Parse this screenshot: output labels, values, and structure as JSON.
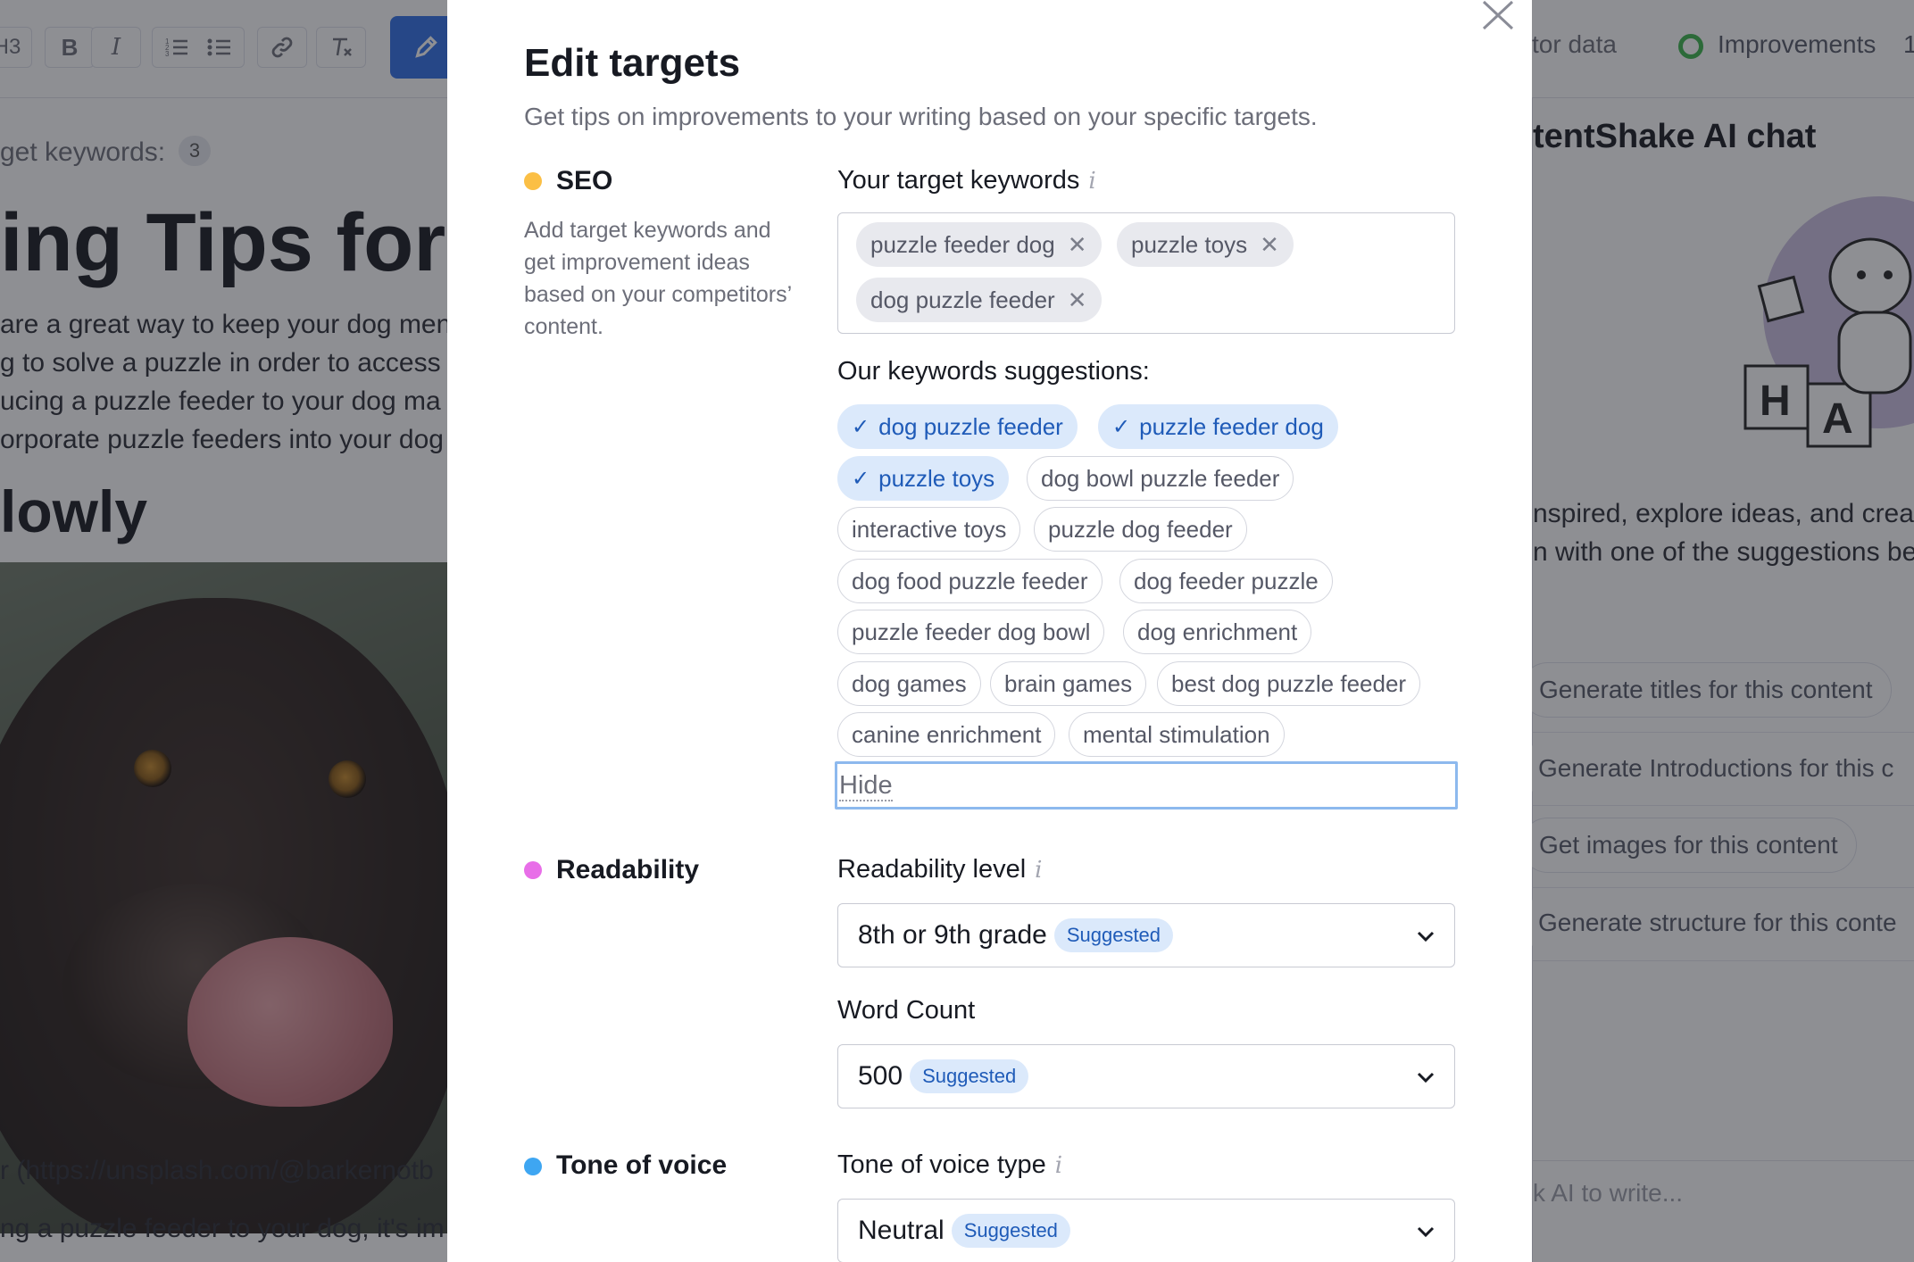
{
  "background": {
    "toolbar": {
      "heading_button": "H3",
      "bold_button": "B",
      "italic_button": "I",
      "competitor_data_label": "tor data",
      "improvements_label": "Improvements",
      "improvements_count": "1"
    },
    "editor": {
      "keywords_label": "get keywords:",
      "keywords_count": "3",
      "title": "ing Tips for U",
      "paragraph": "are a great way to keep your dog men\ng to solve a puzzle in order to access\nucing a puzzle feeder to your dog ma\norporate puzzle feeders into your dog",
      "heading2": "lowly",
      "caption": "r (https://unsplash.com/@barkernotb",
      "paragraph2": "ng a puzzle feeder to your dog, it's im"
    },
    "sidebar": {
      "title": "tentShake AI chat",
      "text": "nspired, explore ideas, and crea\nn with one of the suggestions be",
      "suggestions": [
        "Generate titles for this content",
        "Generate Introductions for this c",
        "Get images for this content",
        "Generate structure for this conte"
      ],
      "input_placeholder": "k AI to write..."
    }
  },
  "modal": {
    "title": "Edit targets",
    "subtitle": "Get tips on improvements to your writing based on your specific targets.",
    "seo": {
      "label": "SEO",
      "color": "#fbbf45",
      "description": "Add target keywords and get improvement ideas based on your competitors’ content.",
      "target_label": "Your target keywords",
      "target_keywords": [
        "puzzle feeder dog",
        "puzzle toys",
        "dog puzzle feeder"
      ],
      "suggestions_label": "Our keywords suggestions:",
      "suggestions": [
        {
          "label": "dog puzzle feeder",
          "selected": true
        },
        {
          "label": "puzzle feeder dog",
          "selected": true
        },
        {
          "label": "puzzle toys",
          "selected": true
        },
        {
          "label": "dog bowl puzzle feeder",
          "selected": false
        },
        {
          "label": "interactive toys",
          "selected": false
        },
        {
          "label": "puzzle dog feeder",
          "selected": false
        },
        {
          "label": "dog food puzzle feeder",
          "selected": false
        },
        {
          "label": "dog feeder puzzle",
          "selected": false
        },
        {
          "label": "puzzle feeder dog bowl",
          "selected": false
        },
        {
          "label": "dog enrichment",
          "selected": false
        },
        {
          "label": "dog games",
          "selected": false
        },
        {
          "label": "brain games",
          "selected": false
        },
        {
          "label": "best dog puzzle feeder",
          "selected": false
        },
        {
          "label": "canine enrichment",
          "selected": false
        },
        {
          "label": "mental stimulation",
          "selected": false
        }
      ],
      "hide_label": "Hide"
    },
    "readability": {
      "label": "Readability",
      "color": "#e86ee8",
      "level_label": "Readability level",
      "level_value": "8th or 9th grade",
      "level_badge": "Suggested",
      "word_count_label": "Word Count",
      "word_count_value": "500",
      "word_count_badge": "Suggested"
    },
    "tone": {
      "label": "Tone of voice",
      "color": "#3ea6f2",
      "type_label": "Tone of voice type",
      "type_value": "Neutral",
      "type_badge": "Suggested"
    }
  }
}
